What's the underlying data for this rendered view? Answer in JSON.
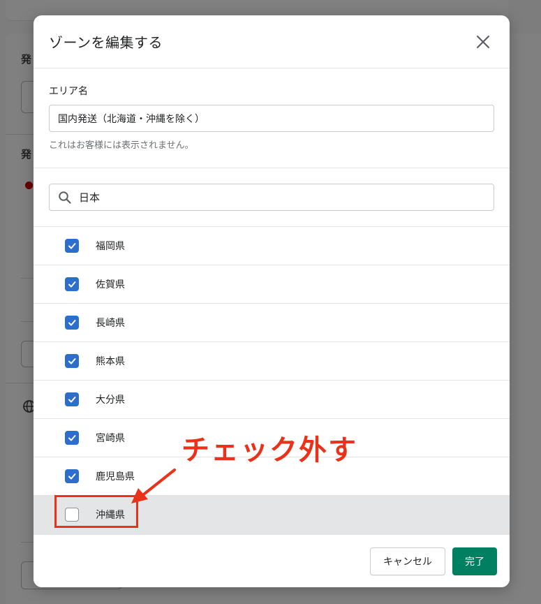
{
  "background": {
    "labels": [
      "発",
      "発"
    ]
  },
  "modal": {
    "title": "ゾーンを編集する",
    "area_name_label": "エリア名",
    "area_name_value": "国内発送（北海道・沖縄を除く）",
    "area_help": "これはお客様には表示されません。",
    "search_value": "日本",
    "prefectures": [
      {
        "name": "福岡県",
        "checked": true
      },
      {
        "name": "佐賀県",
        "checked": true
      },
      {
        "name": "長崎県",
        "checked": true
      },
      {
        "name": "熊本県",
        "checked": true
      },
      {
        "name": "大分県",
        "checked": true
      },
      {
        "name": "宮崎県",
        "checked": true
      },
      {
        "name": "鹿児島県",
        "checked": true
      },
      {
        "name": "沖縄県",
        "checked": false
      }
    ],
    "cancel_label": "キャンセル",
    "done_label": "完了"
  },
  "annotation": {
    "text": "チェック外す",
    "color": "#e8321a"
  },
  "colors": {
    "checkbox_accent": "#2c6ecb",
    "primary_button": "#008060"
  }
}
